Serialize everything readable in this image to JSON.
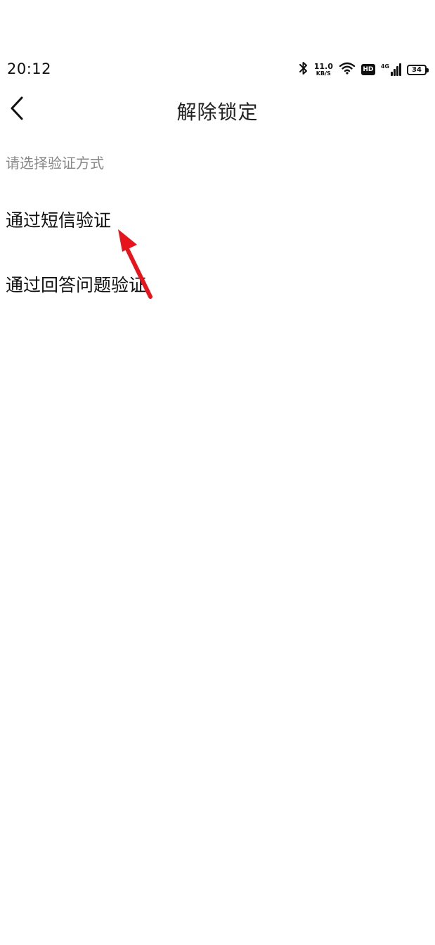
{
  "status_bar": {
    "time": "20:12",
    "network_speed_value": "11.0",
    "network_speed_unit": "KB/S",
    "hd_label": "HD",
    "signal_label": "4G",
    "battery_level": "34",
    "icons": [
      "bluetooth-icon",
      "wifi-icon",
      "hd-icon",
      "signal-icon",
      "battery-icon"
    ]
  },
  "header": {
    "title": "解除锁定",
    "back_icon": "chevron-left-icon"
  },
  "main": {
    "hint": "请选择验证方式",
    "options": [
      {
        "label": "通过短信验证"
      },
      {
        "label": "通过回答问题验证"
      }
    ]
  },
  "annotation": {
    "arrow_color": "#e8141b"
  }
}
